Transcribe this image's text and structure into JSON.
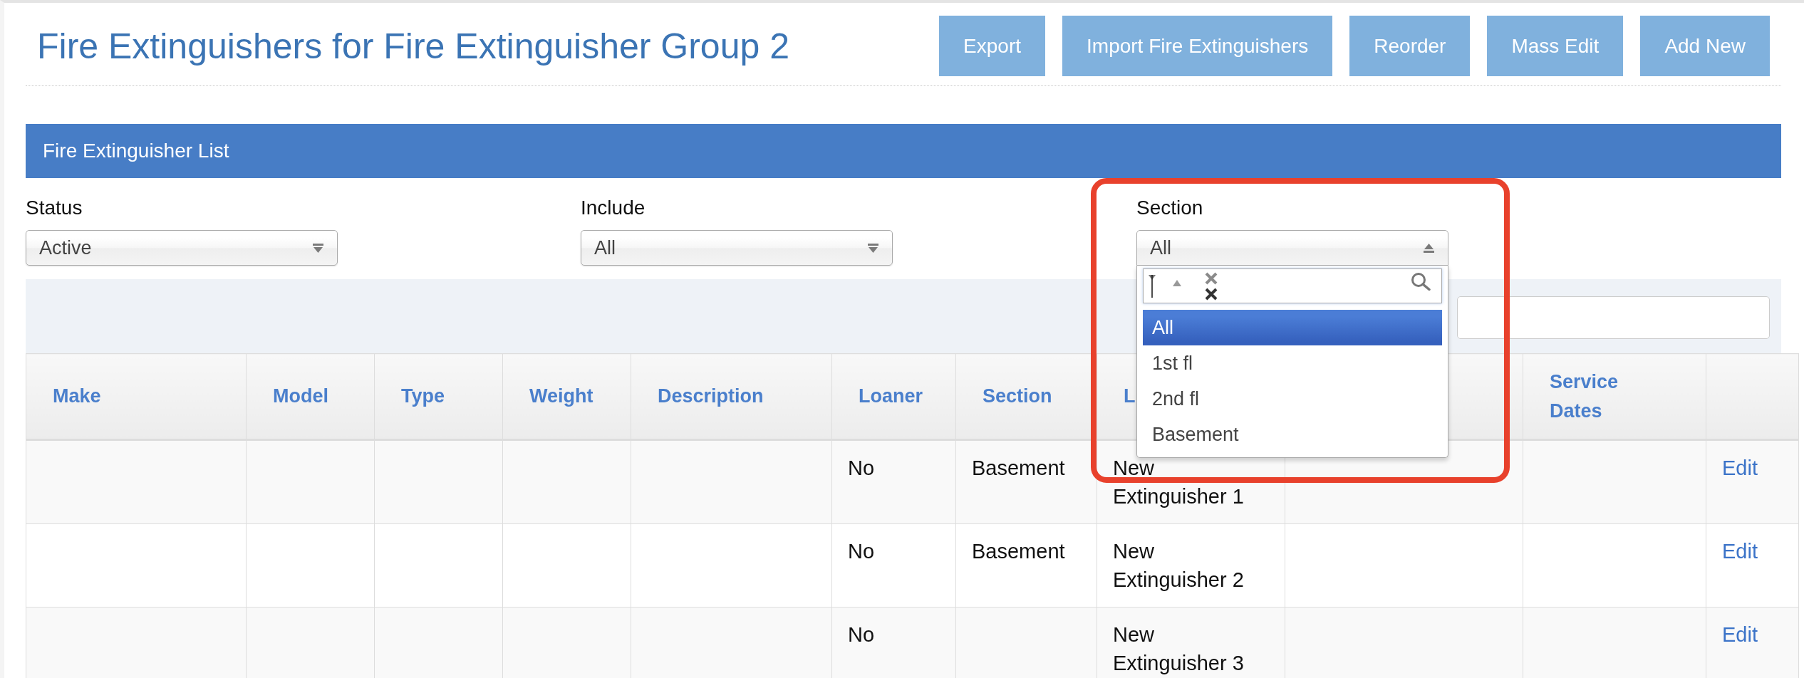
{
  "page": {
    "title": "Fire Extinguishers for Fire Extinguisher Group 2",
    "actions": [
      "Export",
      "Import Fire Extinguishers",
      "Reorder",
      "Mass Edit",
      "Add New"
    ]
  },
  "panel": {
    "title": "Fire Extinguisher List"
  },
  "filters": [
    {
      "label": "Status",
      "value": "Active",
      "expanded": false,
      "highlighted": false
    },
    {
      "label": "Include",
      "value": "All",
      "expanded": false,
      "highlighted": false
    },
    {
      "label": "Section",
      "value": "All",
      "expanded": true,
      "highlighted": true,
      "options": [
        {
          "label": "All",
          "selected": true
        },
        {
          "label": "1st fl",
          "selected": false
        },
        {
          "label": "2nd fl",
          "selected": false
        },
        {
          "label": "Basement",
          "selected": false
        }
      ]
    }
  ],
  "table": {
    "columns": {
      "make": "Make",
      "model": "Model",
      "type": "Type",
      "weight": "Weight",
      "description": "Description",
      "loaner": "Loaner",
      "section": "Section",
      "column_8": "L",
      "service_dates": "Service Dates"
    },
    "rows": [
      {
        "loaner": "No",
        "section": "Basement",
        "column_8": "New Extinguisher 1",
        "column_11": "Edit"
      },
      {
        "loaner": "No",
        "section": "Basement",
        "column_8": "New Extinguisher 2",
        "column_11": "Edit"
      },
      {
        "loaner": "No",
        "column_8": "New Extinguisher 3",
        "column_11": "Edit"
      }
    ]
  }
}
